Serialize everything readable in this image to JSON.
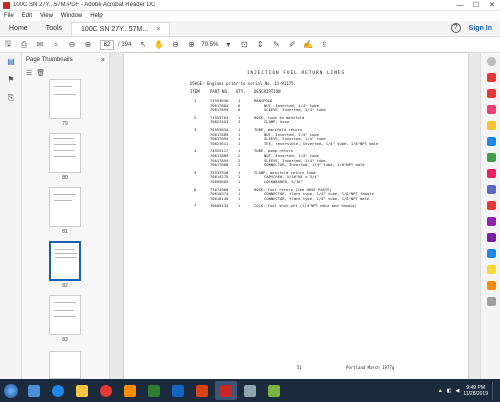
{
  "window": {
    "title": "100C SN 27Y...57M.PDF - Adobe Acrobat Reader DC",
    "controls": [
      "—",
      "☐",
      "✕"
    ]
  },
  "menu": [
    "File",
    "Edit",
    "View",
    "Window",
    "Help"
  ],
  "tabs": {
    "home": "Home",
    "tools": "Tools",
    "document": "100C SN 27Y...57M...",
    "document_close": "×",
    "help_icon": "?",
    "signin": "Sign In"
  },
  "toolbar": {
    "page_current": "82",
    "page_total": "/ 394",
    "zoom": "70.5%"
  },
  "thumbnails": {
    "title": "Page Thumbnails",
    "close": "×",
    "labels": [
      "79",
      "80",
      "81",
      "82",
      "83"
    ]
  },
  "document": {
    "title": "INJECTION FUEL RETURN LINES",
    "usage": "USAGE: Engines prior to serial No. 11-91175.",
    "headers": {
      "item": "ITEM",
      "part": "PART NO.",
      "qty": "QTY.",
      "desc": "DESCRIPTION"
    },
    "rows": [
      {
        "item": "1",
        "part": "74553636",
        "qty": "1",
        "desc": "MANIFOLD"
      },
      {
        "item": "",
        "part": "70617884",
        "qty": "6",
        "desc": "NUT, Inverted, 1/4\" tube"
      },
      {
        "item": "",
        "part": "70617894",
        "qty": "6",
        "desc": "SLEEVE, Inverted, 1/4\" tube"
      },
      {
        "item": "2",
        "part": "74553703",
        "qty": "1",
        "desc": "HOSE, tube to manifold"
      },
      {
        "item": "",
        "part": "70627453",
        "qty": "2",
        "desc": "CLAMP, hose"
      },
      {
        "item": "3",
        "part": "74553634",
        "qty": "1",
        "desc": "TUBE, manifold return"
      },
      {
        "item": "",
        "part": "70617889",
        "qty": "1",
        "desc": "NUT, Inverted, 1/4\" tube"
      },
      {
        "item": "",
        "part": "70617894",
        "qty": "1",
        "desc": "SLEEVE, Inverted, 1/4\" tube"
      },
      {
        "item": "",
        "part": "70623611",
        "qty": "1",
        "desc": "TEE, reversible, Inverted, 1/4\" tube, 1/8\"NPT male"
      },
      {
        "item": "4",
        "part": "74553117",
        "qty": "1",
        "desc": "TUBE, pump return"
      },
      {
        "item": "",
        "part": "70617889",
        "qty": "2",
        "desc": "NUT, Inverted, 1/4\" tube"
      },
      {
        "item": "",
        "part": "70617894",
        "qty": "2",
        "desc": "SLEEVE, Inverted, 1/4\" tube"
      },
      {
        "item": "",
        "part": "70617868",
        "qty": "1",
        "desc": "CONNECTOR, Inverted, 1/4\" tube, 1/8\"NPT male"
      },
      {
        "item": "5",
        "part": "74537940",
        "qty": "1",
        "desc": "CLAMP, manifold return tube"
      },
      {
        "item": "",
        "part": "70614275",
        "qty": "1",
        "desc": "CAPSCREW, 5/16\"NC x 3/4\""
      },
      {
        "item": "",
        "part": "70605605",
        "qty": "1",
        "desc": "LOCKWASHER, 5/16\""
      },
      {
        "item": "6",
        "part": "73674960",
        "qty": "1",
        "desc": "HOSE, fuel return (See HOSE PARTS)"
      },
      {
        "item": "",
        "part": "70610374",
        "qty": "1",
        "desc": "CONNECTOR, flare type, 1/4\" tube, 1/8\"NPT female"
      },
      {
        "item": "",
        "part": "70610140",
        "qty": "1",
        "desc": "CONNECTOR, flare type, 1/4\" tube, 1/8\"NPT male"
      },
      {
        "item": "7",
        "part": "70609433",
        "qty": "1",
        "desc": "COCK, fuel shut-off (1/4\"NPT male and female)"
      }
    ],
    "page_number": "51",
    "footer_right": "Portland March 1977g"
  },
  "taskbar": {
    "time": "9:49 PM",
    "date": "11/28/2019"
  },
  "colors": {
    "accent": "#1a5fb4",
    "acrobat_red": "#c62828",
    "taskbar": "#1b2a3c"
  }
}
